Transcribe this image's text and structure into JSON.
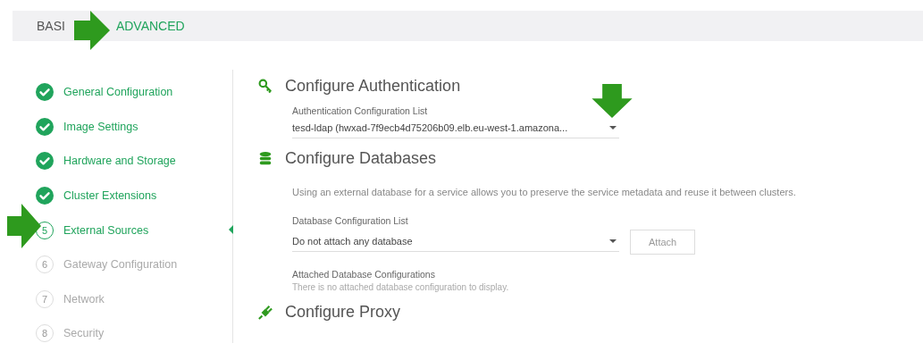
{
  "tabs": [
    {
      "label": "BASI",
      "selected": false
    },
    {
      "label": "ADVANCED",
      "selected": true
    }
  ],
  "steps": [
    {
      "label": "General Configuration",
      "completed": true,
      "selected": false
    },
    {
      "label": "Image Settings",
      "completed": true,
      "selected": false
    },
    {
      "label": "Hardware and Storage",
      "completed": true,
      "selected": false
    },
    {
      "label": "Cluster Extensions",
      "completed": true,
      "selected": false
    },
    {
      "number": "5",
      "label": "External Sources",
      "completed": false,
      "selected": true
    },
    {
      "number": "6",
      "label": "Gateway Configuration",
      "completed": false,
      "selected": false
    },
    {
      "number": "7",
      "label": "Network",
      "completed": false,
      "selected": false
    },
    {
      "number": "8",
      "label": "Security",
      "completed": false,
      "selected": false
    }
  ],
  "sections": [
    {
      "kind": "auth",
      "title": "Configure Authentication",
      "field_label": "Authentication Configuration List",
      "value": "tesd-ldap (hwxad-7f9ecb4d75206b09.elb.eu-west-1.amazona..."
    },
    {
      "kind": "database",
      "title": "Configure Databases",
      "description": "Using an external database for a service allows you to preserve the service metadata and reuse it between clusters.",
      "field_label": "Database Configuration List",
      "value": "Do not attach any database",
      "button": "Attach",
      "attached_label": "Attached Database Configurations",
      "attached_empty": "There is no attached database configuration to display."
    },
    {
      "kind": "proxy",
      "title": "Configure Proxy"
    }
  ]
}
